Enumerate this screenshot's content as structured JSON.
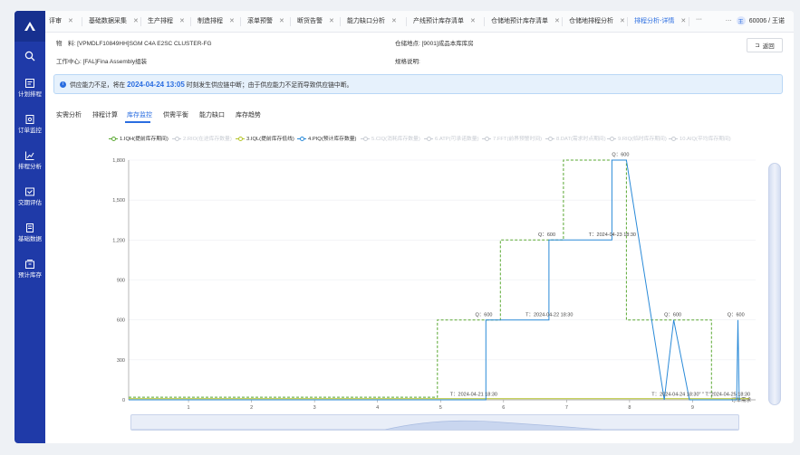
{
  "sidebar": {
    "items": [
      {
        "label": "计划排程",
        "icon": "calendar-icon"
      },
      {
        "label": "订单监控",
        "icon": "monitor-icon"
      },
      {
        "label": "排程分析",
        "icon": "chart-icon"
      },
      {
        "label": "交期评估",
        "icon": "delivery-icon"
      },
      {
        "label": "基础数据",
        "icon": "database-icon"
      },
      {
        "label": "预计库存",
        "icon": "inventory-icon"
      }
    ]
  },
  "tabs": [
    {
      "label": "评审",
      "active": false
    },
    {
      "label": "基础数据采集",
      "active": false
    },
    {
      "label": "生产排程",
      "active": false
    },
    {
      "label": "制造排程",
      "active": false
    },
    {
      "label": "滚单预警",
      "active": false
    },
    {
      "label": "断货告警",
      "active": false
    },
    {
      "label": "能力缺口分析",
      "active": false
    },
    {
      "label": "产线预计库存清单",
      "active": false
    },
    {
      "label": "仓储地预计库存清单",
      "active": false
    },
    {
      "label": "仓储地排程分析",
      "active": false
    },
    {
      "label": "排程分析-详情",
      "active": true
    }
  ],
  "tab_more": "···",
  "user": {
    "avatar": "王",
    "name": "60006 / 王诺"
  },
  "info": {
    "material_label": "物　料:",
    "material_value": "[VPMDLF10849HH]SGM C4A E2SC CLUSTER-FG",
    "warehouse_label": "仓储地点:",
    "warehouse_value": "[9001]成品本库库房",
    "work_center_label": "工作中心:",
    "work_center_value": "[FAL]Fina Assembly组装",
    "rule_label": "规格说明:",
    "rule_value": ""
  },
  "back_button": "返回",
  "alert": {
    "prefix": "供应能力不足，将在",
    "date": "2024-04-24 13:05",
    "suffix": "时刻发生供应链中断；由于供应能力不足而导致供应链中断。"
  },
  "subtabs": [
    {
      "label": "实需分析",
      "active": false
    },
    {
      "label": "排程计算",
      "active": false
    },
    {
      "label": "库存监控",
      "active": true
    },
    {
      "label": "供需平衡",
      "active": false
    },
    {
      "label": "能力缺口",
      "active": false
    },
    {
      "label": "库存趋势",
      "active": false
    }
  ],
  "legend": [
    {
      "label": "1.IQH(提前库存期间)",
      "color": "#5aa832",
      "on": true
    },
    {
      "label": "2.RIO(在途库存数量)",
      "color": "#c8ccd3",
      "on": false
    },
    {
      "label": "3.IQL(提前库存低线)",
      "color": "#b5c42a",
      "on": true
    },
    {
      "label": "4.PIQ(预计库存数量)",
      "color": "#2a8ad8",
      "on": true
    },
    {
      "label": "5.CIQ(消耗库存数量)",
      "color": "#c8ccd3",
      "on": false
    },
    {
      "label": "6.ATP(可承诺数量)",
      "color": "#c8ccd3",
      "on": false
    },
    {
      "label": "7.FFT(前界预警时间)",
      "color": "#c8ccd3",
      "on": false
    },
    {
      "label": "8.DAT(需求时点期间)",
      "color": "#c8ccd3",
      "on": false
    },
    {
      "label": "9.RIQ(临时库存期间)",
      "color": "#c8ccd3",
      "on": false
    },
    {
      "label": "10.AIQ(平均库存期间)",
      "color": "#c8ccd3",
      "on": false
    }
  ],
  "colors": {
    "accent": "#2a6de0",
    "sidebar": "#1f3aa8",
    "iqh": "#5aa832",
    "iql": "#b5c42a",
    "piq": "#2a8ad8"
  },
  "chart_data": {
    "type": "line",
    "x_ticks": [
      "1",
      "2",
      "3",
      "4",
      "5",
      "6",
      "7",
      "8",
      "9"
    ],
    "xlim": [
      0.05,
      10
    ],
    "ylim": [
      0,
      1800
    ],
    "y_ticks": [
      "0",
      "300",
      "600",
      "900",
      "1,200",
      "1,500",
      "1,800"
    ],
    "y_tick_values": [
      0,
      300,
      600,
      900,
      1200,
      1500,
      1800
    ],
    "x_axis_end_label": "订单需求",
    "series": [
      {
        "name": "1.IQH(提前库存期间)",
        "color": "#5aa832",
        "dashed": true,
        "step": true,
        "x": [
          0.05,
          4.95,
          4.95,
          5.95,
          5.95,
          6.95,
          6.95,
          7.95,
          7.95,
          9.3,
          9.3
        ],
        "y": [
          20,
          20,
          600,
          600,
          1200,
          1200,
          1800,
          1800,
          600,
          600,
          0
        ]
      },
      {
        "name": "3.IQL(提前库存低线)",
        "color": "#b5c42a",
        "dashed": false,
        "step": true,
        "x": [
          0.05,
          9.9
        ],
        "y": [
          8,
          8
        ]
      },
      {
        "name": "4.PIQ(预计库存数量)",
        "color": "#2a8ad8",
        "dashed": false,
        "step": false,
        "x": [
          0.05,
          4.0,
          4.02,
          5.72,
          5.72,
          6.72,
          6.72,
          7.72,
          7.72,
          7.95,
          8.55,
          8.7,
          8.95,
          9.7,
          9.72,
          9.74,
          9.76
        ],
        "y": [
          0,
          0,
          0,
          0,
          600,
          600,
          1200,
          1200,
          1800,
          1800,
          0,
          600,
          0,
          0,
          600,
          0,
          0
        ]
      }
    ],
    "annotations": [
      {
        "x": 5.15,
        "y": 30,
        "text": "T：2024-04-21 18:30"
      },
      {
        "x": 5.55,
        "y": 630,
        "text": "Q：600"
      },
      {
        "x": 6.35,
        "y": 630,
        "text": "T：2024-04-22 18:30"
      },
      {
        "x": 6.55,
        "y": 1230,
        "text": "Q：600"
      },
      {
        "x": 7.35,
        "y": 1230,
        "text": "T：2024-04-23 18:30"
      },
      {
        "x": 7.72,
        "y": 1830,
        "text": "Q：600"
      },
      {
        "x": 8.55,
        "y": 630,
        "text": "Q：600"
      },
      {
        "x": 8.35,
        "y": 30,
        "text": "T：2024-04-24 18:30\" \" T:\"2024-04-25 18:30"
      },
      {
        "x": 9.55,
        "y": 630,
        "text": "Q：600"
      }
    ]
  }
}
